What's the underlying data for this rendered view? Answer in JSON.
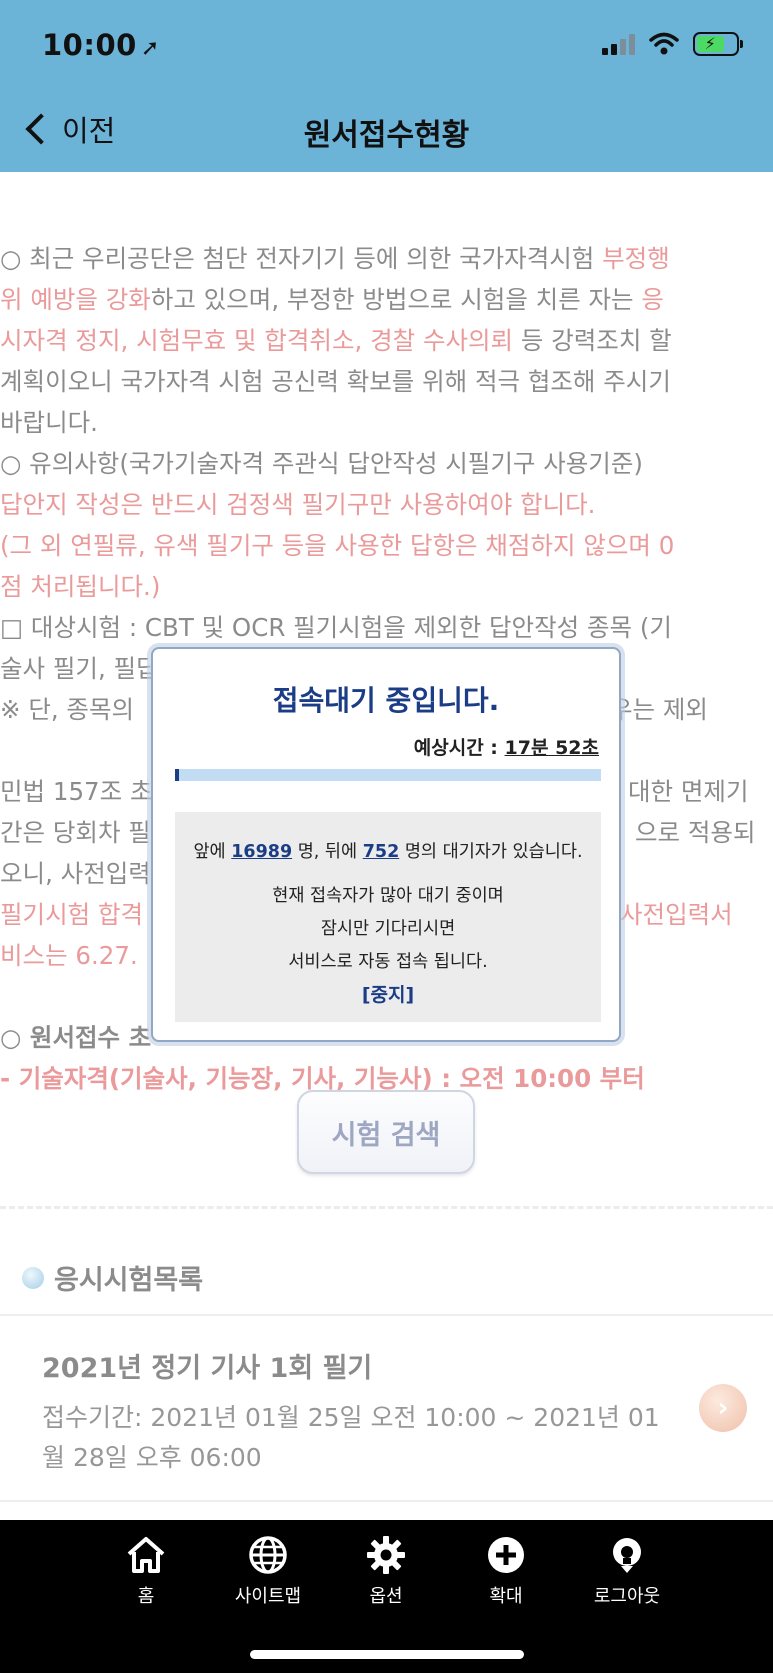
{
  "status_bar": {
    "time": "10:00"
  },
  "nav": {
    "back_label": "이전",
    "title": "원서접수현황"
  },
  "notice": {
    "line1": {
      "t1": "○ 최근 우리공단은 첨단 전자기기 등에 의한 국가자격시험 ",
      "t2": "부정행"
    },
    "line2": {
      "t1": "위 예방을 강화",
      "t2": "하고 있으며, 부정한 방법으로 시험을 치른 자는 ",
      "t3": "응"
    },
    "line3": {
      "t1": "시자격 정지, 시험무효 및 합격취소, 경찰 수사의뢰",
      "t2": " 등 강력조치 할"
    },
    "line4": "계획이오니 국가자격 시험 공신력 확보를 위해 적극 협조해 주시기",
    "line5": "바랍니다.",
    "line6": "○ 유의사항(국가기술자격 주관식 답안작성 시필기구 사용기준)",
    "line7": "답안지 작성은 반드시 검정색 필기구만 사용하여야 합니다.",
    "line8": "(그 외 연필류, 유색 필기구 등을 사용한 답항은 채점하지 않으며 0",
    "line9": "점 처리됩니다.)",
    "line10": "□ 대상시험 : CBT 및 OCR 필기시험을 제외한 답안작성 종목 (기",
    "line11": "술사 필기, 필답형 실기, 작업형 실기 등)",
    "line12": {
      "t1": "※ 단, 종목의",
      "t2": "우는 제외"
    },
    "line13": {
      "t1": "민법 157조 초",
      "t2": "대한 면제기"
    },
    "line14": {
      "t1": "간은 당회차 필",
      "t2": "으로 적용되"
    },
    "line15": {
      "t1": "오니, 사전입력",
      "t2": ""
    },
    "line16": {
      "t1": "필기시험 합격",
      "t2": "사전입력서"
    },
    "line17": {
      "t1": "비스는 6.27.",
      "t2": ""
    },
    "line18": "○ 원서접수 초",
    "line19": "- 기술자격(기술사, 기능장, 기사, 기능사) : 오전 10:00 부터"
  },
  "search_button": "시험 검색",
  "exam_list": {
    "heading": "응시시험목록",
    "items": [
      {
        "title": "2021년 정기 기사 1회 필기",
        "period": "접수기간: 2021년 01월 25일 오전 10:00 ~ 2021년 01월 28일 오후 06:00"
      }
    ]
  },
  "queue_modal": {
    "title": "접속대기 중입니다.",
    "eta_label": "예상시간 :",
    "eta_value": "17분 52초",
    "progress": 0.01,
    "ahead_prefix": "앞에",
    "ahead_count": "16989",
    "ahead_suffix": "명, 뒤에",
    "behind_count": "752",
    "behind_suffix": "명의 대기자가 있습니다.",
    "msg1": "현재 접속자가 많아 대기 중이며",
    "msg2": "잠시만 기다리시면",
    "msg3": "서비스로 자동 접속 됩니다.",
    "stop_label": "[중지]"
  },
  "tabbar": {
    "items": [
      {
        "label": "홈",
        "icon": "home-icon"
      },
      {
        "label": "사이트맵",
        "icon": "globe-icon"
      },
      {
        "label": "옵션",
        "icon": "gear-icon"
      },
      {
        "label": "확대",
        "icon": "plus-circle-icon"
      },
      {
        "label": "로그아웃",
        "icon": "logout-icon"
      }
    ]
  },
  "colors": {
    "header": "#6cb3d8",
    "accent_red": "#e06a6a",
    "modal_blue": "#1b3d86"
  }
}
